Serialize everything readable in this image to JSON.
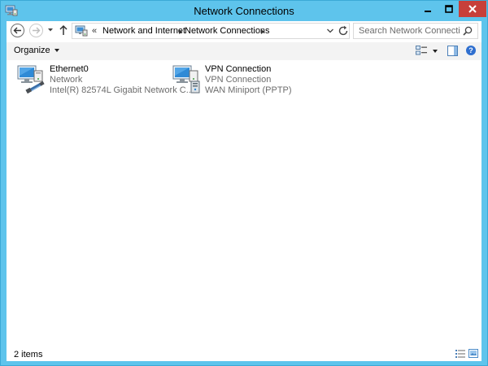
{
  "window": {
    "title": "Network Connections",
    "accent_color": "#5ec4ec",
    "close_color": "#c7403a"
  },
  "address_bar": {
    "overflow": "«",
    "crumbs": [
      "Network and Internet",
      "Network Connections"
    ]
  },
  "search": {
    "placeholder": "Search Network Connections"
  },
  "command_bar": {
    "organize_label": "Organize"
  },
  "items": [
    {
      "name": "Ethernet0",
      "type": "Network",
      "device": "Intel(R) 82574L Gigabit Network C...",
      "icon": "ethernet-adapter-icon"
    },
    {
      "name": "VPN Connection",
      "type": "VPN Connection",
      "device": "WAN Miniport (PPTP)",
      "icon": "vpn-adapter-icon"
    }
  ],
  "status_bar": {
    "item_count": "2 items"
  },
  "help_glyph": "?"
}
